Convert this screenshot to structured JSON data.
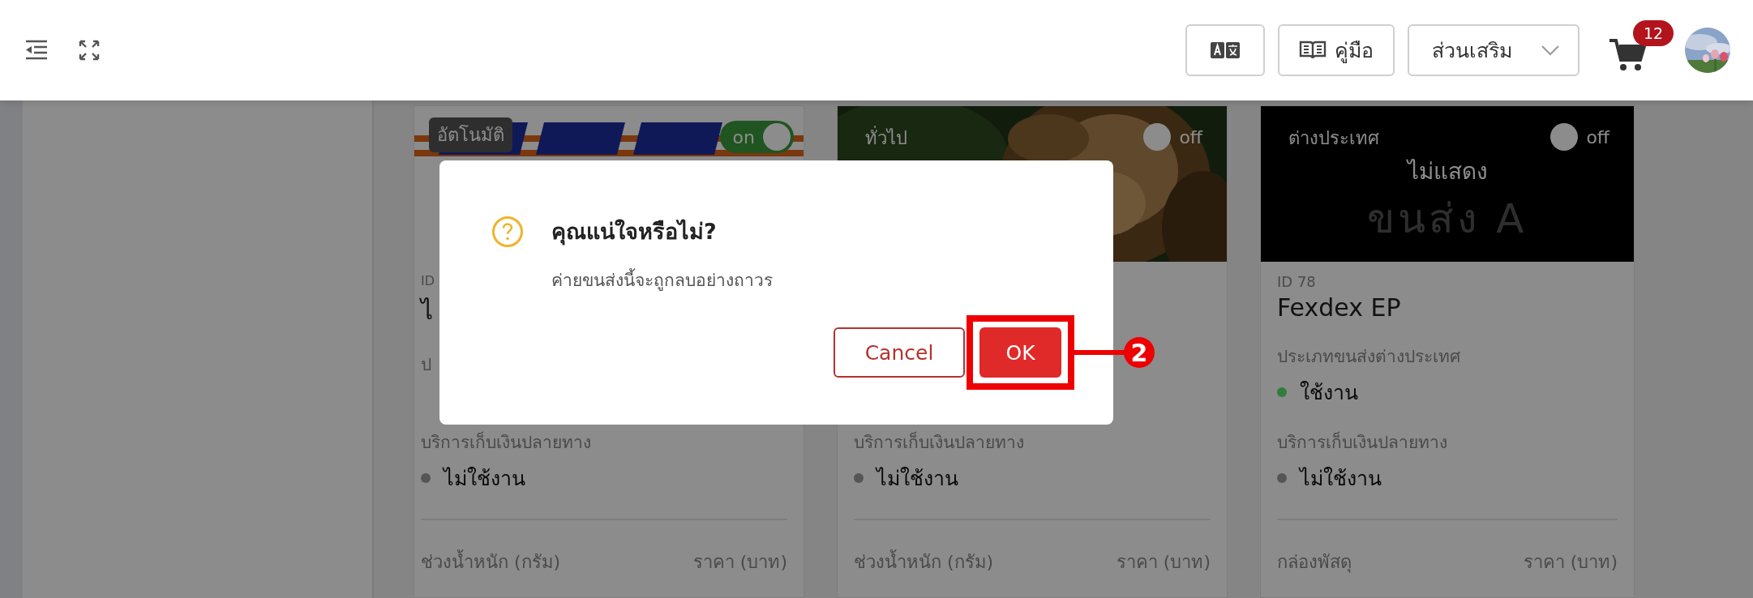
{
  "header": {
    "manual_button": "คู่มือ",
    "addons_dropdown": "ส่วนเสริม",
    "cart_badge": "12"
  },
  "cards": [
    {
      "kind": "logo",
      "tag": "อัตโนมัติ",
      "toggle": {
        "on": true,
        "label": "on"
      },
      "id": "ID",
      "name": "ไ",
      "type_label": "ป",
      "cod_label": "บริการเก็บเงินปลายทาง",
      "cod_status": {
        "text": "ไม่ใช้งาน",
        "color": "#555555"
      },
      "col_left": "ช่วงน้ำหนัก (กรัม)",
      "col_right": "ราคา (บาท)"
    },
    {
      "tag": "ทั่วไป",
      "toggle": {
        "on": false,
        "label": "off"
      },
      "cod_label": "บริการเก็บเงินปลายทาง",
      "cod_status": {
        "text": "ไม่ใช้งาน",
        "color": "#555555"
      },
      "col_left": "ช่วงน้ำหนัก (กรัม)",
      "col_right": "ราคา (บาท)"
    },
    {
      "kind": "blank",
      "tag": "ต่างประเทศ",
      "toggle": {
        "on": false,
        "label": "off"
      },
      "image_text": "ขนส่ง A",
      "overlay_label": "ไม่แสดง",
      "id": "ID 78",
      "name": "Fexdex EP",
      "type_label": "ประเภทขนส่งต่างประเทศ",
      "type_status": {
        "text": "ใช้งาน",
        "color": "#2f7d3a"
      },
      "cod_label": "บริการเก็บเงินปลายทาง",
      "cod_status": {
        "text": "ไม่ใช้งาน",
        "color": "#555555"
      },
      "col_left": "กล่องพัสดุ",
      "col_right": "ราคา (บาท)"
    }
  ],
  "dialog": {
    "title": "คุณแน่ใจหรือไม่?",
    "message": "ค่ายขนส่งนี้จะถูกลบอย่างถาวร",
    "buttons": [
      {
        "label": "Cancel",
        "kind": "secondary"
      },
      {
        "label": "OK",
        "kind": "primary"
      }
    ]
  },
  "annotation": {
    "number": "2"
  }
}
